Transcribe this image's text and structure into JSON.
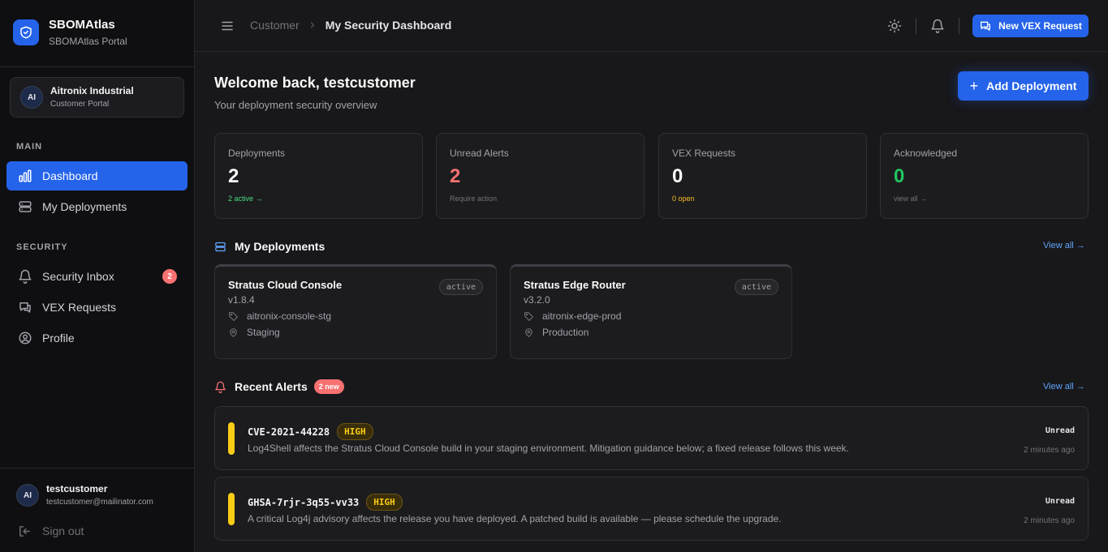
{
  "brand": {
    "name": "SBOMAtlas",
    "subtitle": "SBOMAtlas Portal"
  },
  "org": {
    "initials": "AI",
    "name": "Aitronix Industrial",
    "subtitle": "Customer Portal"
  },
  "sidebar": {
    "main_label": "MAIN",
    "security_label": "SECURITY",
    "items": [
      {
        "label": "Dashboard",
        "icon": "bar-chart-icon",
        "active": true
      },
      {
        "label": "My Deployments",
        "icon": "server-icon"
      },
      {
        "label": "Security Inbox",
        "icon": "bell-icon",
        "badge": "2"
      },
      {
        "label": "VEX Requests",
        "icon": "chat-icon"
      },
      {
        "label": "Profile",
        "icon": "user-circle-icon"
      }
    ]
  },
  "user": {
    "initials": "AI",
    "name": "testcustomer",
    "email": "testcustomer@mailinator.com",
    "signout_label": "Sign out"
  },
  "header": {
    "breadcrumb_parent": "Customer",
    "breadcrumb_current": "My Security Dashboard",
    "new_vex_label": "New VEX Request"
  },
  "welcome": {
    "title": "Welcome back, testcustomer",
    "subtitle": "Your deployment security overview",
    "add_label": "Add Deployment"
  },
  "stats": [
    {
      "label": "Deployments",
      "value": "2",
      "foot": "2 active →",
      "value_color": "#fafafa",
      "foot_color": "#4ade80"
    },
    {
      "label": "Unread Alerts",
      "value": "2",
      "foot": "Require action",
      "value_color": "#f87171",
      "foot_color": "#71717a"
    },
    {
      "label": "VEX Requests",
      "value": "0",
      "foot": "0 open",
      "value_color": "#fafafa",
      "foot_color": "#fbbf24"
    },
    {
      "label": "Acknowledged",
      "value": "0",
      "foot": "view all →",
      "value_color": "#22c55e",
      "foot_color": "#71717a"
    }
  ],
  "deployments_section": {
    "title": "My Deployments",
    "view_all": "View all →"
  },
  "deployments": [
    {
      "name": "Stratus Cloud Console",
      "version": "v1.8.4",
      "status": "active",
      "tag": "aitronix-console-stg",
      "env": "Staging"
    },
    {
      "name": "Stratus Edge Router",
      "version": "v3.2.0",
      "status": "active",
      "tag": "aitronix-edge-prod",
      "env": "Production"
    }
  ],
  "alerts_section": {
    "title": "Recent Alerts",
    "new_badge": "2 new",
    "view_all": "View all →"
  },
  "alerts": [
    {
      "id": "CVE-2021-44228",
      "severity": "HIGH",
      "description": "Log4Shell affects the Stratus Cloud Console build in your staging environment. Mitigation guidance below; a fixed release follows this week.",
      "state": "Unread",
      "time": "2 minutes ago"
    },
    {
      "id": "GHSA-7rjr-3q55-vv33",
      "severity": "HIGH",
      "description": "A critical Log4j advisory affects the release you have deployed. A patched build is available — please schedule the upgrade.",
      "state": "Unread",
      "time": "2 minutes ago"
    }
  ]
}
